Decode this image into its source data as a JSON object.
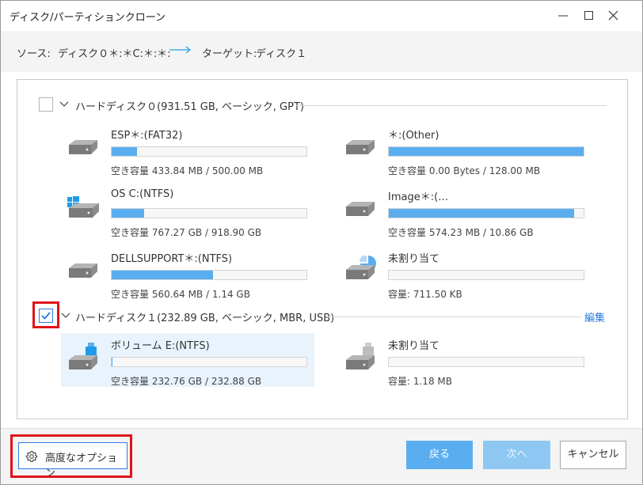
{
  "window": {
    "title": "ディスク/パーティションクローン"
  },
  "source": {
    "source_label": "ソース:",
    "source_value": "ディスク０＊:＊C:＊:＊:",
    "target_label": "ターゲット:",
    "target_value": "ディスク１"
  },
  "disks": [
    {
      "label": "ハードディスク０(931.51 GB, ベーシック, GPT)",
      "checked": false,
      "partitions": [
        {
          "name": "ESP＊:(FAT32)",
          "info": "空き容量 433.84 MB / 500.00 MB",
          "used_fraction": 0.13,
          "icon": "drive-icon"
        },
        {
          "name": "＊:(Other)",
          "info": "空き容量 0.00 Bytes / 128.00 MB",
          "used_fraction": 1.0,
          "icon": "drive-icon"
        },
        {
          "name": "OS C:(NTFS)",
          "info": "空き容量 767.27 GB / 918.90 GB",
          "used_fraction": 0.165,
          "icon": "windows-drive-icon"
        },
        {
          "name": "Image＊:(…",
          "info": "空き容量 574.23 MB / 10.86 GB",
          "used_fraction": 0.95,
          "icon": "drive-icon"
        },
        {
          "name": "DELLSUPPORT＊:(NTFS)",
          "info": "空き容量 560.64 MB / 1.14 GB",
          "used_fraction": 0.52,
          "icon": "drive-icon"
        },
        {
          "name": "未割り当て",
          "info": "容量: 711.50 KB",
          "used_fraction": 0,
          "icon": "unallocated-drive-icon"
        }
      ]
    },
    {
      "label": "ハードディスク１(232.89 GB, ベーシック, MBR, USB)",
      "checked": true,
      "edit_label": "編集",
      "partitions": [
        {
          "name": "ボリューム E:(NTFS)",
          "info": "空き容量 232.76 GB / 232.88 GB",
          "used_fraction": 0.004,
          "icon": "usb-drive-icon",
          "selected": true
        },
        {
          "name": "未割り当て",
          "info": "容量: 1.18 MB",
          "used_fraction": 0,
          "icon": "usb-drive-icon"
        }
      ]
    }
  ],
  "footer": {
    "advanced_label": "高度なオプション",
    "back_label": "戻る",
    "next_label": "次へ",
    "cancel_label": "キャンセル"
  },
  "colors": {
    "accent": "#2a7ae2",
    "bar_fill": "#5aaeef",
    "highlight": "#e0131a"
  }
}
